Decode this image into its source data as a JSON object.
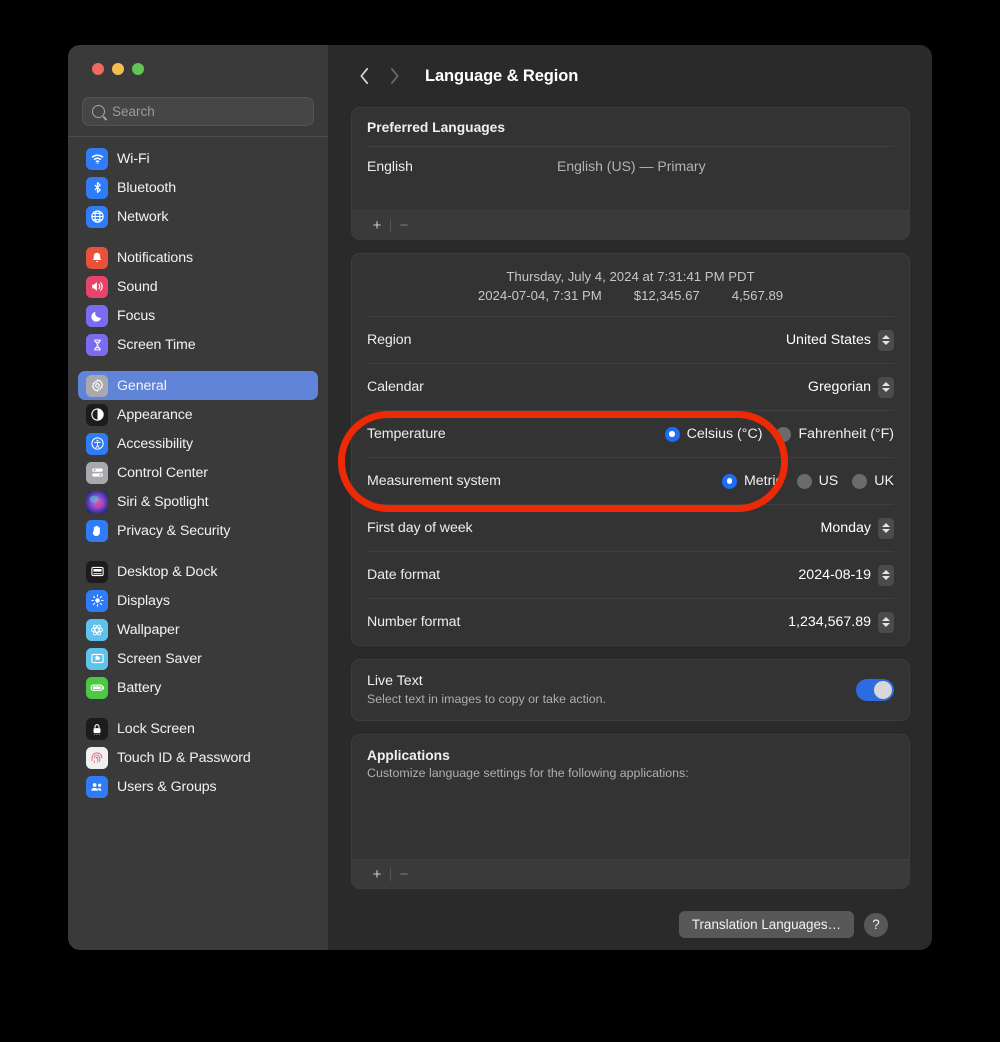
{
  "window": {
    "title": "Language & Region",
    "traffic_lights": [
      "close",
      "minimize",
      "maximize"
    ]
  },
  "sidebar": {
    "search": {
      "placeholder": "Search",
      "value": ""
    },
    "groups": [
      {
        "items": [
          {
            "label": "Wi-Fi",
            "icon": "wifi-icon",
            "color": "#2f7cf6",
            "selected": false
          },
          {
            "label": "Bluetooth",
            "icon": "bluetooth-icon",
            "color": "#2f7cf6",
            "selected": false
          },
          {
            "label": "Network",
            "icon": "globe-icon",
            "color": "#2f7cf6",
            "selected": false
          }
        ]
      },
      {
        "items": [
          {
            "label": "Notifications",
            "icon": "bell-icon",
            "color": "#e8513c",
            "selected": false
          },
          {
            "label": "Sound",
            "icon": "speaker-icon",
            "color": "#e8436b",
            "selected": false
          },
          {
            "label": "Focus",
            "icon": "moon-icon",
            "color": "#7a6cf0",
            "selected": false
          },
          {
            "label": "Screen Time",
            "icon": "hourglass-icon",
            "color": "#7a6cf0",
            "selected": false
          }
        ]
      },
      {
        "items": [
          {
            "label": "General",
            "icon": "gear-icon",
            "color": "#8e8e93",
            "selected": true
          },
          {
            "label": "Appearance",
            "icon": "contrast-icon",
            "color": "#1c1c1e",
            "selected": false
          },
          {
            "label": "Accessibility",
            "icon": "accessibility-icon",
            "color": "#2f7cf6",
            "selected": false
          },
          {
            "label": "Control Center",
            "icon": "sliders-icon",
            "color": "#8e8e93",
            "selected": false
          },
          {
            "label": "Siri & Spotlight",
            "icon": "siri-icon",
            "color": "#5c3f8e",
            "selected": false
          },
          {
            "label": "Privacy & Security",
            "icon": "hand-icon",
            "color": "#2f7cf6",
            "selected": false
          }
        ]
      },
      {
        "items": [
          {
            "label": "Desktop & Dock",
            "icon": "desktop-icon",
            "color": "#1c1c1e",
            "selected": false
          },
          {
            "label": "Displays",
            "icon": "brightness-icon",
            "color": "#2f7cf6",
            "selected": false
          },
          {
            "label": "Wallpaper",
            "icon": "wallpaper-icon",
            "color": "#5ec2ec",
            "selected": false
          },
          {
            "label": "Screen Saver",
            "icon": "screensaver-icon",
            "color": "#5ec2ec",
            "selected": false
          },
          {
            "label": "Battery",
            "icon": "battery-icon",
            "color": "#4cc746",
            "selected": false
          }
        ]
      },
      {
        "items": [
          {
            "label": "Lock Screen",
            "icon": "lock-icon",
            "color": "#1c1c1e",
            "selected": false
          },
          {
            "label": "Touch ID & Password",
            "icon": "fingerprint-icon",
            "color": "#f2f2f2",
            "selected": false
          },
          {
            "label": "Users & Groups",
            "icon": "users-icon",
            "color": "#2f7cf6",
            "selected": false
          }
        ]
      }
    ]
  },
  "toolbar": {
    "back_icon": "chevron-left-icon",
    "forward_icon": "chevron-right-icon",
    "title": "Language & Region"
  },
  "preferred_languages": {
    "title": "Preferred Languages",
    "rows": [
      {
        "name": "English",
        "detail": "English (US) — Primary"
      }
    ],
    "add_label": "+",
    "remove_label": "−"
  },
  "formats": {
    "preview_line1": "Thursday, July 4, 2024 at 7:31:41 PM PDT",
    "preview_datetime": "2024-07-04, 7:31 PM",
    "preview_currency": "$12,345.67",
    "preview_number": "4,567.89",
    "rows": [
      {
        "label": "Region",
        "value": "United States",
        "control": "stepper"
      },
      {
        "label": "Calendar",
        "value": "Gregorian",
        "control": "stepper"
      }
    ],
    "temperature": {
      "label": "Temperature",
      "options": [
        {
          "label": "Celsius (°C)",
          "selected": true
        },
        {
          "label": "Fahrenheit (°F)",
          "selected": false
        }
      ]
    },
    "measurement": {
      "label": "Measurement system",
      "options": [
        {
          "label": "Metric",
          "selected": true
        },
        {
          "label": "US",
          "selected": false
        },
        {
          "label": "UK",
          "selected": false
        }
      ]
    },
    "rows_after": [
      {
        "label": "First day of week",
        "value": "Monday",
        "control": "stepper"
      },
      {
        "label": "Date format",
        "value": "2024-08-19",
        "control": "stepper"
      },
      {
        "label": "Number format",
        "value": "1,234,567.89",
        "control": "stepper"
      }
    ]
  },
  "live_text": {
    "title": "Live Text",
    "subtitle": "Select text in images to copy or take action.",
    "enabled": true
  },
  "applications": {
    "title": "Applications",
    "subtitle": "Customize language settings for the following applications:",
    "add_label": "+",
    "remove_label": "−"
  },
  "footer": {
    "translation_button": "Translation Languages…",
    "help_button": "?"
  },
  "annotation": {
    "shape": "ellipse-outline",
    "color": "#ee2a06",
    "targets": [
      "Temperature",
      "Measurement system"
    ]
  }
}
